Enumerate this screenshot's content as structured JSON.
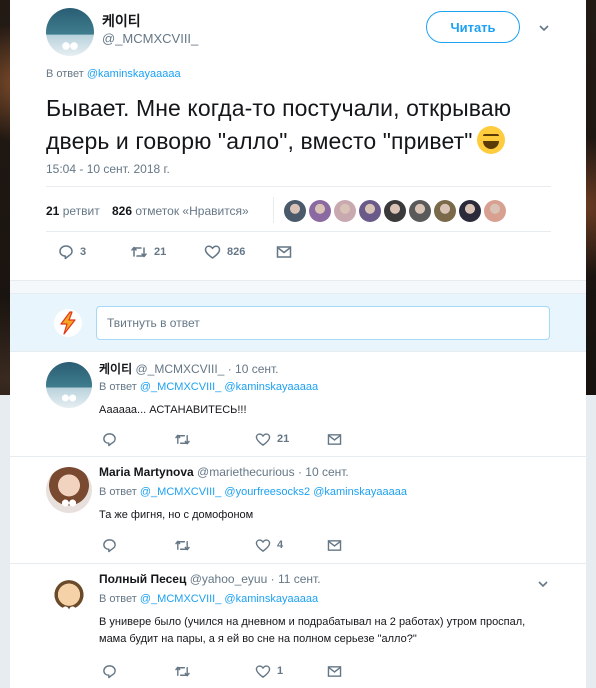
{
  "main_tweet": {
    "display_name": "케이티",
    "handle": "@_MCMXCVIII_",
    "follow_label": "Читать",
    "reply_prefix": "В ответ",
    "reply_mention": "@kaminskayaaaaa",
    "text": "Бывает. Мне когда-то постучали, открываю дверь и говорю \"алло\", вместо \"привет\"",
    "emoji": "laughing-emoji",
    "timestamp": "15:04 - 10 сент. 2018 г.",
    "stats": {
      "retweets_count": "21",
      "retweets_label": "ретвит",
      "likes_count": "826",
      "likes_label": "отметок «Нравится»"
    },
    "liker_colors": [
      "#4a5a6a",
      "#8a6aa0",
      "#c9a9b0",
      "#6a5a8a",
      "#3a3a3a",
      "#5a5a5a",
      "#7a6a4a",
      "#2a2a3a",
      "#d8a090"
    ],
    "actions": {
      "replies": "3",
      "retweets": "21",
      "likes": "826"
    }
  },
  "composer": {
    "placeholder": "Твитнуть в ответ"
  },
  "replies": [
    {
      "display_name": "케이티",
      "handle": "@_MCMXCVIII_",
      "time": "· 10 сент.",
      "reply_prefix": "В ответ",
      "mentions": "@_MCMXCVIII_ @kaminskayaaaaa",
      "text": "Аааааа... АСТАНАВИТЕСЬ!!!",
      "reply_count": "",
      "retweet_count": "",
      "like_count": "21"
    },
    {
      "display_name": "Maria Martynova",
      "handle": "@mariethecurious",
      "time": "· 10 сент.",
      "reply_prefix": "В ответ",
      "mentions": "@_MCMXCVIII_ @yourfreesocks2 @kaminskayaaaaa",
      "text": "Та же фигня, но с домофоном",
      "reply_count": "",
      "retweet_count": "",
      "like_count": "4"
    },
    {
      "display_name": "Полный Песец",
      "handle": "@yahoo_eyuu",
      "time": "· 11 сент.",
      "reply_prefix": "В ответ",
      "mentions": "@_MCMXCVIII_ @kaminskayaaaaa",
      "text": "В универе было (учился на дневном и подрабатывал на 2 работах) утром проспал, мама будит на пары, а я ей во сне на полном серьезе \"алло?\"",
      "reply_count": "",
      "retweet_count": "",
      "like_count": "1"
    }
  ]
}
